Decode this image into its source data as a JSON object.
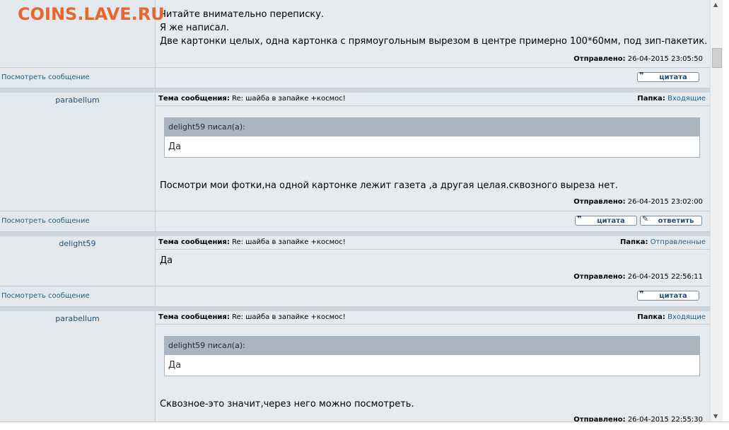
{
  "watermark": "COINS.LAVE.RU",
  "labels": {
    "view_message": "Посмотреть сообщение",
    "quote_btn": "цитата",
    "reply_btn": "ответить",
    "subject_label": "Тема сообщения:",
    "folder_label": "Папка:",
    "sent_label": "Отправлено:",
    "wrote_suffix": "писал(а):"
  },
  "messages": [
    {
      "lines": [
        "Читайте внимательно переписку.",
        "Я же написал.",
        "Две картонки целых, одна картонка с прямоугольным вырезом в центре примерно 100*60мм, под зип-пакетик."
      ],
      "sent": "26-04-2015 23:05:50"
    },
    {
      "author": "parabellum",
      "subject": "Re: шайба в запайке +космос!",
      "folder": "Входящие",
      "quote_head": "delight59 писал(а):",
      "quote_body": "Да",
      "text": "Посмотри мои фотки,на одной картонке лежит газета ,а другая целая.сквозного выреза нет.",
      "sent": "26-04-2015 23:02:00"
    },
    {
      "author": "delight59",
      "subject": "Re: шайба в запайке +космос!",
      "folder": "Отправленные",
      "text": "Да",
      "sent": "26-04-2015 22:56:11"
    },
    {
      "author": "parabellum",
      "subject": "Re: шайба в запайке +космос!",
      "folder": "Входящие",
      "quote_head": "delight59 писал(а):",
      "quote_body": "Да",
      "text": "Сквозное-это значит,через него можно посмотреть.",
      "sent": "26-04-2015 22:55:30"
    }
  ]
}
